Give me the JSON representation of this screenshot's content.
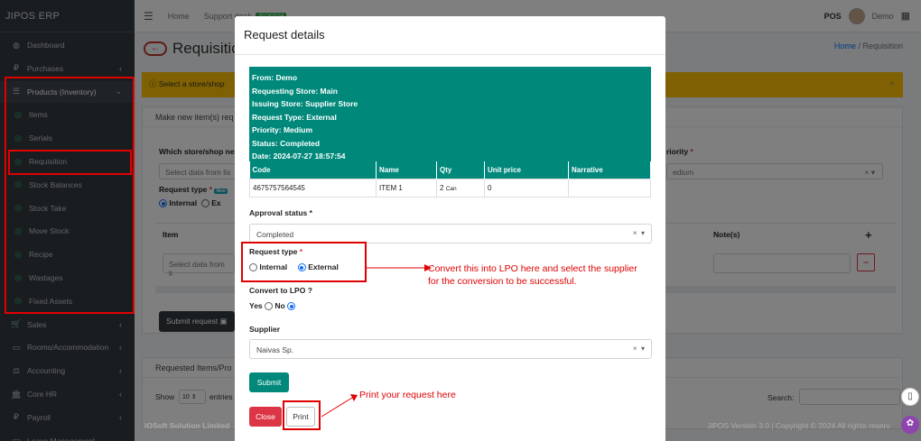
{
  "app": {
    "brand": "JIPOS ERP"
  },
  "sidebar": {
    "items": [
      {
        "label": "Dashboard",
        "icon": "dashboard-icon",
        "glyph": "◍",
        "chevron": ""
      },
      {
        "label": "Purchases",
        "icon": "purchases-icon",
        "glyph": "₽",
        "chevron": "‹"
      },
      {
        "label": "Products (Inventory)",
        "icon": "products-icon",
        "glyph": "☰",
        "chevron": "⌄"
      },
      {
        "label": "Items",
        "icon": "circle-icon",
        "glyph": "◎",
        "chevron": ""
      },
      {
        "label": "Serials",
        "icon": "circle-icon",
        "glyph": "◎",
        "chevron": ""
      },
      {
        "label": "Requisition",
        "icon": "circle-icon",
        "glyph": "◎",
        "chevron": ""
      },
      {
        "label": "Stock Balances",
        "icon": "circle-icon",
        "glyph": "◎",
        "chevron": ""
      },
      {
        "label": "Stock Take",
        "icon": "circle-icon",
        "glyph": "◎",
        "chevron": ""
      },
      {
        "label": "Move Stock",
        "icon": "circle-icon",
        "glyph": "◎",
        "chevron": ""
      },
      {
        "label": "Recipe",
        "icon": "circle-icon",
        "glyph": "◎",
        "chevron": ""
      },
      {
        "label": "Wastages",
        "icon": "circle-icon",
        "glyph": "◎",
        "chevron": ""
      },
      {
        "label": "Fixed Assets",
        "icon": "circle-icon",
        "glyph": "◎",
        "chevron": ""
      },
      {
        "label": "Sales",
        "icon": "cart-icon",
        "glyph": "🛒",
        "chevron": "‹"
      },
      {
        "label": "Rooms/Accommodation",
        "icon": "bed-icon",
        "glyph": "▭",
        "chevron": "‹"
      },
      {
        "label": "Accounting",
        "icon": "scale-icon",
        "glyph": "⚖",
        "chevron": "‹"
      },
      {
        "label": "Core HR",
        "icon": "bank-icon",
        "glyph": "🏛",
        "chevron": "‹"
      },
      {
        "label": "Payroll",
        "icon": "payroll-icon",
        "glyph": "₽",
        "chevron": "‹"
      },
      {
        "label": "Leave Management",
        "icon": "leave-icon",
        "glyph": "▭",
        "chevron": ""
      }
    ]
  },
  "topbar": {
    "home": "Home",
    "support": "Support desk",
    "badge": "2023/2024",
    "pos": "POS",
    "user": "Demo"
  },
  "page": {
    "title": "Requisition",
    "breadcrumb_home": "Home",
    "breadcrumb_sep": "/",
    "breadcrumb_current": "Requisition",
    "alert": "Select a store/shop",
    "alert_close": "×",
    "card_title": "Make new item(s) req",
    "store_label": "Which store/shop ne",
    "store_placeholder": "Select data from lis",
    "priority_label": "riority",
    "priority_value": "edium",
    "request_type_label": "Request type",
    "request_type_new": "New",
    "internal": "Internal",
    "ex": "Ex",
    "item_col": "Item",
    "note_col": "Note(s)",
    "item_placeholder": "Select data from li",
    "plus": "+",
    "minus": "−",
    "submit_request": "Submit request",
    "requested_items": "Requested Items/Pro",
    "show": "Show",
    "show_count": "10",
    "entries": "entries",
    "search": "Search:"
  },
  "modal": {
    "title": "Request details",
    "info": {
      "from": "From: Demo",
      "requesting": "Requesting Store: Main",
      "issuing": "Issuing Store: Supplier Store",
      "type": "Request Type: External",
      "priority": "Priority: Medium",
      "status": "Status: Completed",
      "date": "Date: 2024-07-27 18:57:54"
    },
    "table": {
      "headers": [
        "Code",
        "Name",
        "Qty",
        "Unit price",
        "Narrative"
      ],
      "rows": [
        {
          "code": "4675757564545",
          "name": "ITEM 1",
          "qty": "2",
          "unit": "Can",
          "price": "0",
          "narrative": ""
        }
      ]
    },
    "approval_label": "Approval status",
    "approval_value": "Completed",
    "request_type_label": "Request type",
    "internal": "Internal",
    "external": "External",
    "selected_type": "External",
    "convert_label": "Convert to LPO ?",
    "yes": "Yes",
    "no": "No",
    "selected_convert": "No",
    "supplier_label": "Supplier",
    "supplier_value": "Naivas Sp.",
    "submit": "Submit",
    "close": "Close",
    "print": "Print"
  },
  "annotations": {
    "convert_note_line1": "Convert this into LPO here and select the supplier",
    "convert_note_line2": "for the conversion to be successful.",
    "print_note": "Print your request here"
  },
  "footer": {
    "left": "iOSoft Solution Limited",
    "right": "JiPOS Version 3.0 | Copyright © 2024 All rights reserv"
  },
  "colors": {
    "sidebar": "#343a40",
    "teal": "#00897b",
    "alert": "#ffc107",
    "danger": "#dc3545",
    "annotation": "#e00000"
  }
}
